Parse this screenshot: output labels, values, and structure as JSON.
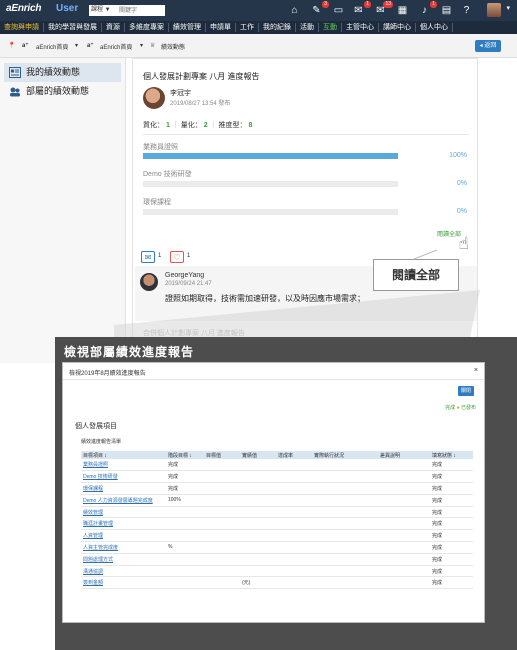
{
  "header": {
    "logo": "aEnrich",
    "logo_suffix": "User",
    "search_type": "課程 ▼",
    "search_placeholder": "關鍵字",
    "icon_badges": [
      "3",
      "1",
      "13",
      "1"
    ]
  },
  "nav": {
    "items": [
      {
        "label": "查詢與申請",
        "style": "active"
      },
      {
        "label": "我的學習與發展",
        "style": ""
      },
      {
        "label": "資源",
        "style": ""
      },
      {
        "label": "多維度專案",
        "style": ""
      },
      {
        "label": "績效管理",
        "style": ""
      },
      {
        "label": "申請單",
        "style": ""
      },
      {
        "label": "工作",
        "style": ""
      },
      {
        "label": "我的紀錄",
        "style": ""
      },
      {
        "label": "活動",
        "style": ""
      },
      {
        "label": "互動",
        "style": "green"
      },
      {
        "label": "主管中心",
        "style": ""
      },
      {
        "label": "講師中心",
        "style": ""
      },
      {
        "label": "個人中心",
        "style": ""
      }
    ]
  },
  "breadcrumb": {
    "items": [
      "aEnrich首頁",
      "aEnrich首頁",
      "績效動態"
    ],
    "back_label": "返回"
  },
  "sidebar": {
    "items": [
      {
        "label": "我的績效動態"
      },
      {
        "label": "部屬的績效動態"
      }
    ]
  },
  "post": {
    "title": "個人發展計劃專案 八月 進度報告",
    "author": "李冠宇",
    "time": "2019/08/27 13:54 發布",
    "stats": {
      "qual_label": "質化：",
      "qual_value": "1",
      "quant_label": "量化：",
      "quant_value": "2",
      "prog_label": "推度型：",
      "prog_value": "8"
    },
    "progress": [
      {
        "label": "業務員證照",
        "percent": 100,
        "pct_label": "100%"
      },
      {
        "label": "Demo 技術研發",
        "percent": 0,
        "pct_label": "0%"
      },
      {
        "label": "環保課程",
        "percent": 0,
        "pct_label": "0%"
      }
    ],
    "read_all": "閱讀全部",
    "likes_comment": "1",
    "likes_heart": "1",
    "comment": {
      "name": "GeorgeYang",
      "time": "2019/09/24 21:47",
      "text": "證照如期取得，技術需加速研發，以及時因應市場需求；"
    },
    "next_faded": "合併個人計劃專案 八月 進度報告"
  },
  "callout_read_all": "閱讀全部",
  "overlay": {
    "title": "檢視部屬績效進度報告"
  },
  "modal": {
    "title": "檢視2019年8月績效進度報告",
    "close": "×",
    "button": "關閉",
    "legend_done": "完成",
    "legend_pending": "已發布",
    "section": "個人發展項目",
    "subsection": "績效進度報告清單",
    "columns": [
      "目標項目 ↕",
      "階段目標 ↕",
      "目標值",
      "實績值",
      "達成率",
      "實際執行狀況",
      "差異說明",
      "填寫狀態 ↕"
    ],
    "rows": [
      [
        "業務員證照",
        "完成",
        "",
        "",
        "",
        "",
        "",
        "完成"
      ],
      [
        "Demo 技術研發",
        "完成",
        "",
        "",
        "",
        "",
        "",
        "完成"
      ],
      [
        "環保課程",
        "完成",
        "",
        "",
        "",
        "",
        "",
        "完成"
      ],
      [
        "Demo 人力資源發展專題完成度",
        "100%",
        "",
        "",
        "",
        "",
        "",
        "完成"
      ],
      [
        "績效管理",
        "",
        "",
        "",
        "",
        "",
        "",
        "完成"
      ],
      [
        "職涯計畫管理",
        "",
        "",
        "",
        "",
        "",
        "",
        "完成"
      ],
      [
        "人資管理",
        "",
        "",
        "",
        "",
        "",
        "",
        "完成"
      ],
      [
        "人資主管完成度",
        "%",
        "",
        "",
        "",
        "",
        "",
        "完成"
      ],
      [
        "問題處理方式",
        "",
        "",
        "",
        "",
        "",
        "",
        "完成"
      ],
      [
        "溝通協調",
        "",
        "",
        "",
        "",
        "",
        "",
        "完成"
      ],
      [
        "簽到金額",
        "",
        "",
        "(元)",
        "",
        "",
        "",
        "完成"
      ]
    ]
  }
}
